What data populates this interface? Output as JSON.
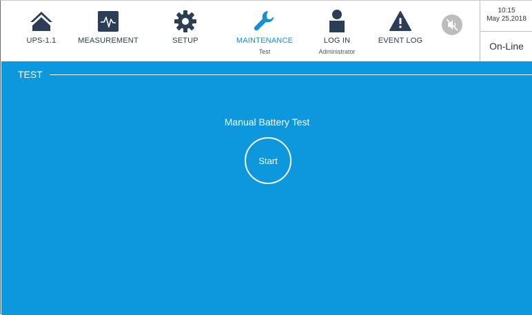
{
  "nav": {
    "ups": {
      "label": "UPS-1.1",
      "icon": "home-icon"
    },
    "measurement": {
      "label": "MEASUREMENT",
      "icon": "waveform-icon"
    },
    "setup": {
      "label": "SETUP",
      "icon": "gear-icon"
    },
    "maintenance": {
      "label": "MAINTENANCE",
      "sub": "Test",
      "icon": "wrench-icon"
    },
    "login": {
      "label": "LOG IN",
      "sub": "Administrator",
      "icon": "user-icon"
    },
    "eventlog": {
      "label": "EVENT LOG",
      "icon": "warning-icon"
    },
    "mute": {
      "icon": "speaker-muted-icon"
    }
  },
  "clock": {
    "time": "10:15",
    "date": "May 25,2018"
  },
  "status": "On-Line",
  "section": {
    "title": "TEST"
  },
  "test": {
    "title": "Manual Battery Test",
    "start_label": "Start"
  },
  "colors": {
    "accent": "#0d97dd",
    "icon_dark": "#2c3e55",
    "active": "#1290d8",
    "muted": "#bdbdbd"
  }
}
